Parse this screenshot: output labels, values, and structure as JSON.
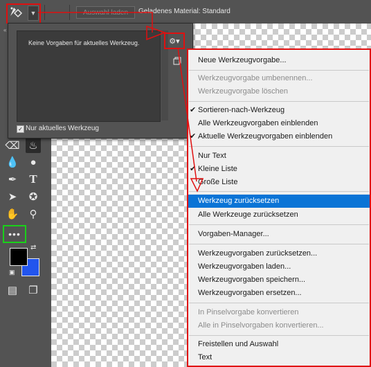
{
  "optionsbar": {
    "load_button": "Auswahl laden",
    "loaded_material": "Geladenes Material: Standard"
  },
  "panel": {
    "empty_message": "Keine Vorgaben für aktuelles Werkzeug.",
    "current_tool_only_label": "Nur aktuelles Werkzeug",
    "current_tool_only_checked": true
  },
  "menu": {
    "items": [
      {
        "label": "Neue Werkzeugvorgabe...",
        "enabled": true
      },
      {
        "label": "Werkzeugvorgabe umbenennen...",
        "enabled": false
      },
      {
        "label": "Werkzeugvorgabe löschen",
        "enabled": false
      },
      {
        "label": "Sortieren-nach-Werkzeug",
        "enabled": true,
        "checked": true
      },
      {
        "label": "Alle Werkzeugvorgaben einblenden",
        "enabled": true
      },
      {
        "label": "Aktuelle Werkzeugvorgaben einblenden",
        "enabled": true,
        "checked": true
      },
      {
        "label": "Nur Text",
        "enabled": true
      },
      {
        "label": "Kleine Liste",
        "enabled": true,
        "checked": true
      },
      {
        "label": "Große Liste",
        "enabled": true
      },
      {
        "label": "Werkzeug zurücksetzen",
        "enabled": true,
        "highlighted": true
      },
      {
        "label": "Alle Werkzeuge zurücksetzen",
        "enabled": true
      },
      {
        "label": "Vorgaben-Manager...",
        "enabled": true
      },
      {
        "label": "Werkzeugvorgaben zurücksetzen...",
        "enabled": true
      },
      {
        "label": "Werkzeugvorgaben laden...",
        "enabled": true
      },
      {
        "label": "Werkzeugvorgaben speichern...",
        "enabled": true
      },
      {
        "label": "Werkzeugvorgaben ersetzen...",
        "enabled": true
      },
      {
        "label": "In Pinselvorgabe konvertieren",
        "enabled": false
      },
      {
        "label": "Alle in Pinselvorgaben konvertieren...",
        "enabled": false
      },
      {
        "label": "Freistellen und Auswahl",
        "enabled": true
      },
      {
        "label": "Text",
        "enabled": true
      }
    ]
  },
  "colors": {
    "foreground": "#000000",
    "background": "#2255ee",
    "annotation_red": "#e01010",
    "annotation_green": "#19d119",
    "menu_highlight": "#0a74d6"
  },
  "icons": [
    "tool-preset-icon",
    "chevron-down-icon",
    "gear-icon",
    "new-preset-icon",
    "eraser-icon",
    "paint-bucket-icon",
    "blur-drop-icon",
    "dodge-icon",
    "pen-icon",
    "type-icon",
    "path-selection-icon",
    "custom-shape-icon",
    "hand-icon",
    "zoom-icon",
    "more-tools-icon",
    "swap-colors-icon",
    "default-colors-icon",
    "quick-mask-icon",
    "screen-mode-icon"
  ]
}
